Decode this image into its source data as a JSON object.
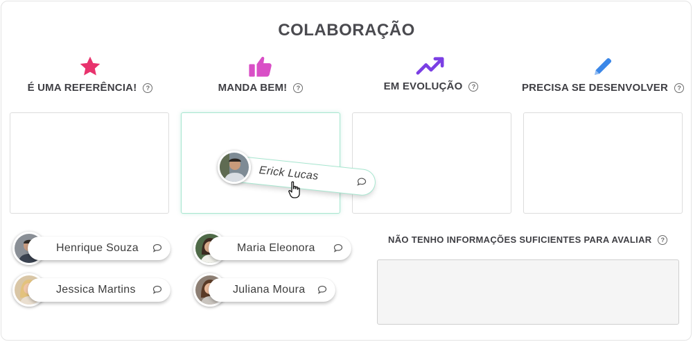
{
  "title": "COLABORAÇÃO",
  "help_glyph": "?",
  "categories": [
    {
      "label": "É UMA REFERÊNCIA!",
      "icon": "star-icon",
      "color": "#e8336d"
    },
    {
      "label": "MANDA BEM!",
      "icon": "thumbs-up-icon",
      "color": "#d94fc6"
    },
    {
      "label": "EM EVOLUÇÃO",
      "icon": "trending-up-icon",
      "color": "#7b3fe4"
    },
    {
      "label": "PRECISA SE DESENVOLVER",
      "icon": "pencil-icon",
      "color": "#3b87e8"
    }
  ],
  "dragging": {
    "name": "Erick Lucas"
  },
  "people": [
    {
      "name": "Henrique Souza"
    },
    {
      "name": "Maria Eleonora"
    },
    {
      "name": "Jessica Martins"
    },
    {
      "name": "Juliana Moura"
    }
  ],
  "no_info": {
    "label": "NÃO TENHO INFORMAÇÕES SUFICIENTES PARA AVALIAR"
  }
}
